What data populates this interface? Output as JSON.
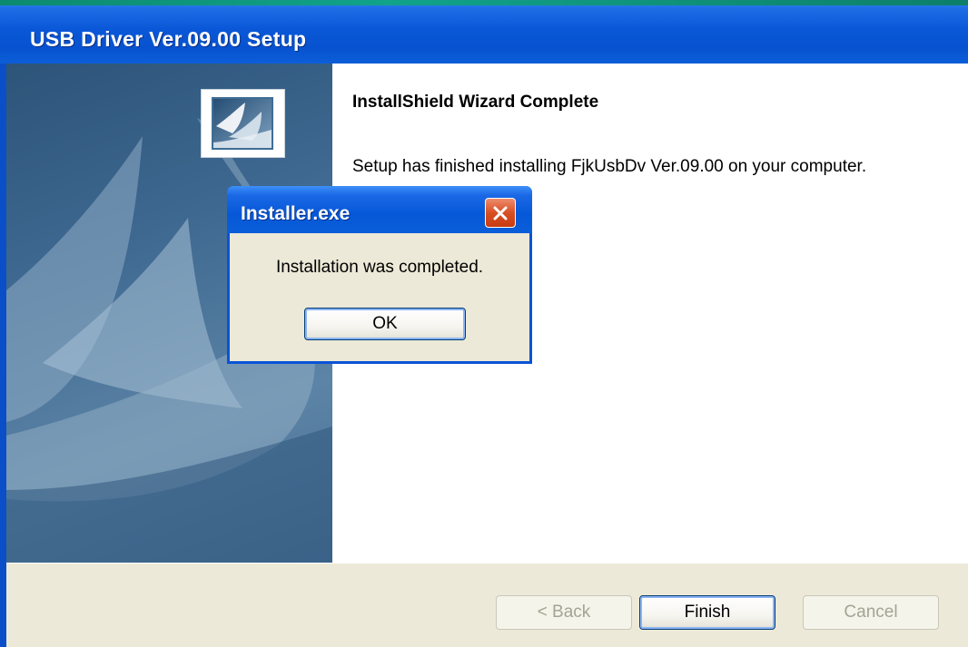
{
  "setup_window": {
    "title": "USB Driver Ver.09.00 Setup",
    "heading": "InstallShield Wizard Complete",
    "message": "Setup has finished installing FjkUsbDv Ver.09.00 on your computer.",
    "buttons": {
      "back": "< Back",
      "finish": "Finish",
      "cancel": "Cancel"
    }
  },
  "dialog": {
    "title": "Installer.exe",
    "message": "Installation was completed.",
    "ok_label": "OK",
    "close_icon": "close-icon"
  },
  "colors": {
    "titlebar_blue": "#0a58d8",
    "close_red": "#d84f24",
    "dialog_face": "#ece9d8"
  }
}
